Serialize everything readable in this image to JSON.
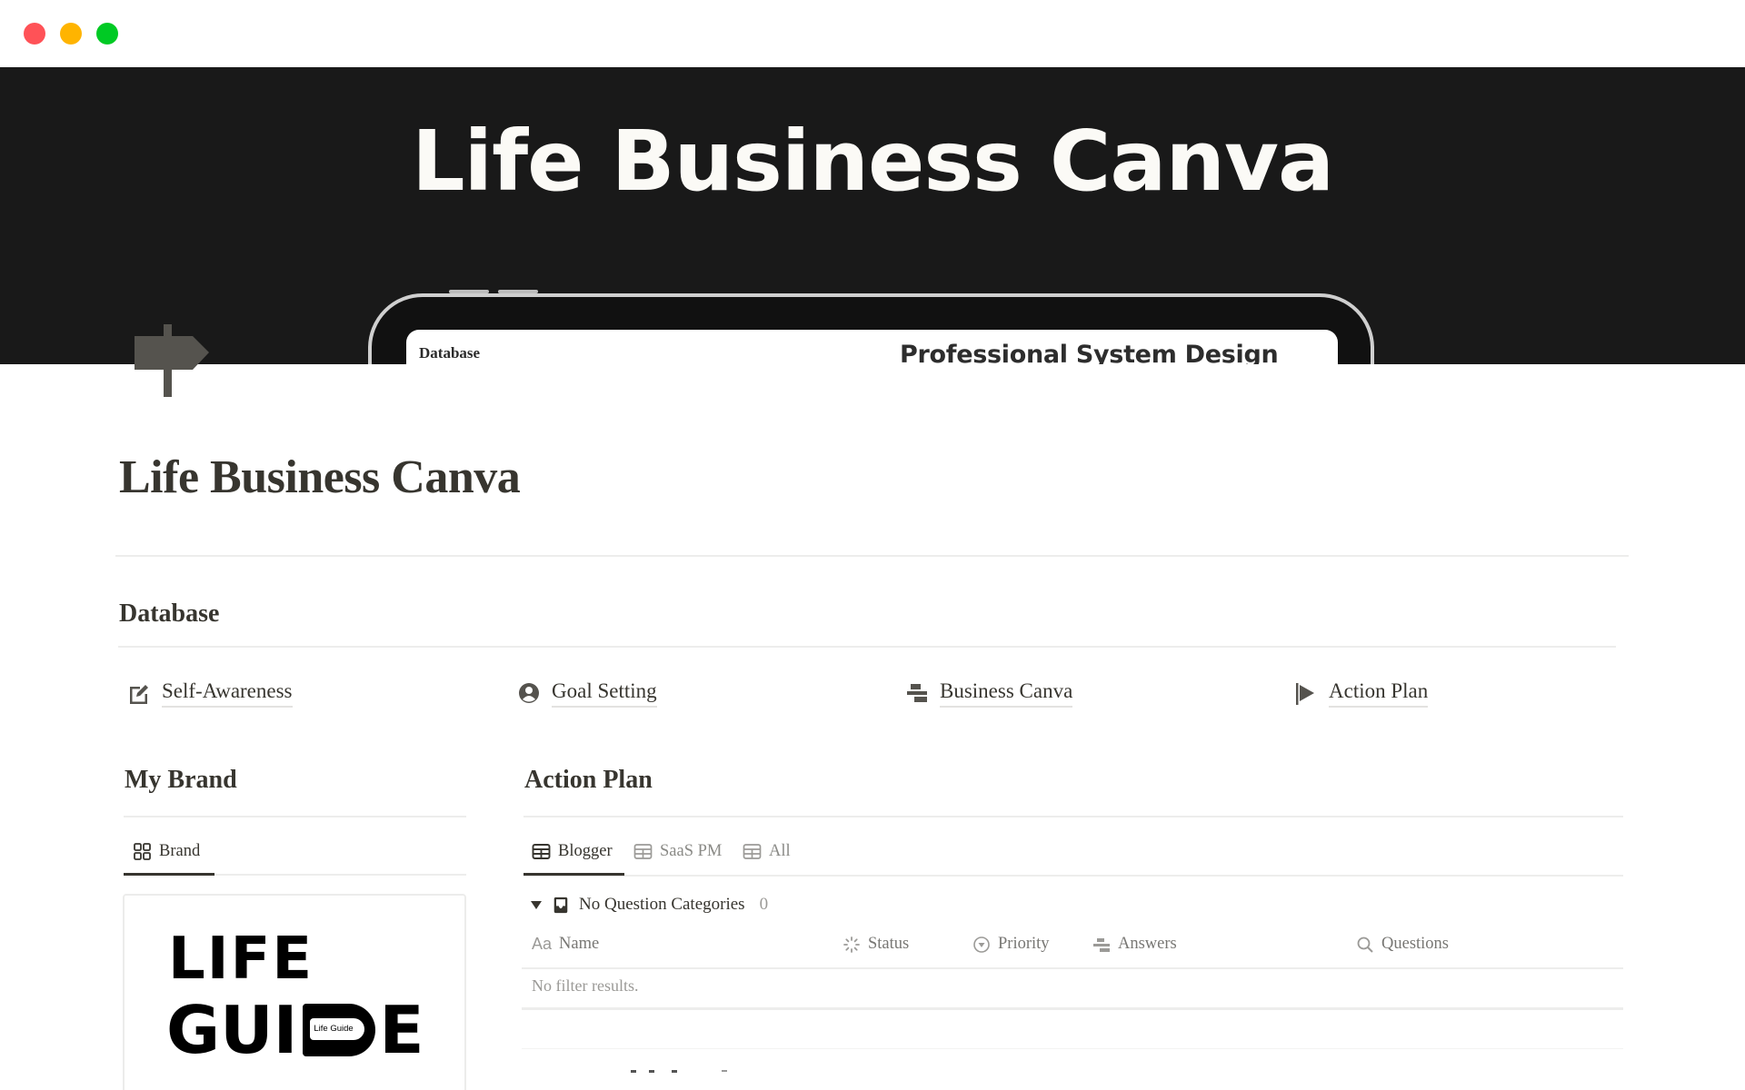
{
  "window": {
    "traffic_lights": [
      "close",
      "minimize",
      "zoom"
    ]
  },
  "cover": {
    "title": "Life Business Canva",
    "device_screen": {
      "left_label": "Database",
      "heading": "Professional System Design"
    },
    "background_color": "#191919"
  },
  "page": {
    "icon": "signpost-icon",
    "title": "Life Business Canva"
  },
  "database_section": {
    "heading": "Database",
    "links": [
      {
        "label": "Self-Awareness",
        "icon": "edit-square-icon"
      },
      {
        "label": "Goal Setting",
        "icon": "user-circle-icon"
      },
      {
        "label": "Business Canva",
        "icon": "stacked-blocks-icon"
      },
      {
        "label": "Action Plan",
        "icon": "flag-icon"
      }
    ]
  },
  "my_brand": {
    "heading": "My Brand",
    "tabs": [
      {
        "label": "Brand",
        "icon": "gallery-icon",
        "active": true
      }
    ],
    "card": {
      "logo_line1": "LIFE",
      "logo_line2_start": "GUI",
      "logo_inner_text": "Life Guide",
      "logo_line2_end": "E"
    }
  },
  "action_plan": {
    "heading": "Action Plan",
    "tabs": [
      {
        "label": "Blogger",
        "icon": "table-icon",
        "active": true
      },
      {
        "label": "SaaS PM",
        "icon": "table-icon",
        "active": false
      },
      {
        "label": "All",
        "icon": "table-icon",
        "active": false
      }
    ],
    "group": {
      "label": "No Question Categories",
      "count": "0",
      "expanded": true
    },
    "columns": [
      {
        "label": "Name",
        "icon": "text-aa-icon"
      },
      {
        "label": "Status",
        "icon": "status-spinner-icon"
      },
      {
        "label": "Priority",
        "icon": "select-circle-icon"
      },
      {
        "label": "Answers",
        "icon": "relation-blocks-icon"
      },
      {
        "label": "Questions",
        "icon": "search-icon"
      }
    ],
    "empty_message": "No filter results."
  }
}
